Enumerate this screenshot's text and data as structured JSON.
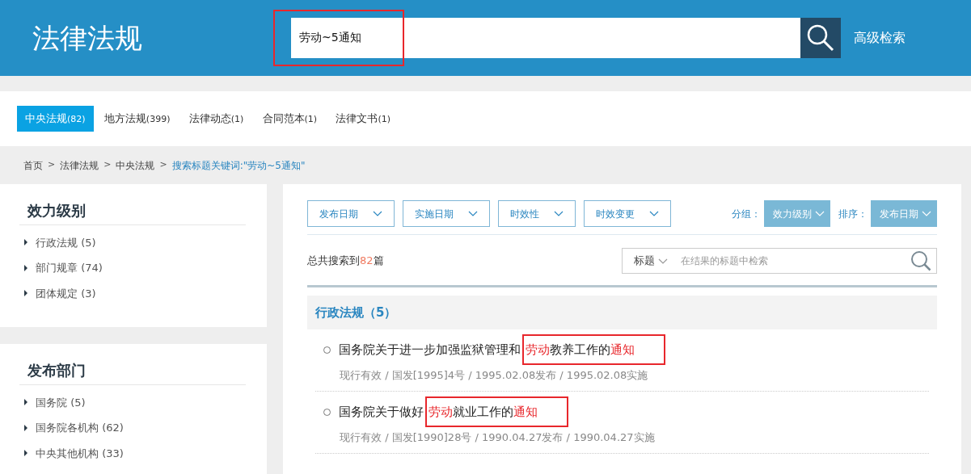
{
  "header": {
    "title": "法律法规",
    "search": {
      "value": "劳动~5通知",
      "annotated": true
    },
    "advanced_link": "高级检索"
  },
  "tabs": [
    {
      "label": "中央法规",
      "count": "(82)",
      "selected": true
    },
    {
      "label": "地方法规",
      "count": "(399)",
      "selected": false
    },
    {
      "label": "法律动态",
      "count": "(1)",
      "selected": false
    },
    {
      "label": "合同范本",
      "count": "(1)",
      "selected": false
    },
    {
      "label": "法律文书",
      "count": "(1)",
      "selected": false
    }
  ],
  "breadcrumb_separator": ">",
  "breadcrumb": [
    {
      "label": "首页",
      "current": false
    },
    {
      "label": "法律法规",
      "current": false
    },
    {
      "label": "中央法规",
      "current": false
    },
    {
      "label": "搜索标题关键词:\"劳动~5通知\"",
      "current": true
    }
  ],
  "sidebar": [
    {
      "title": "效力级别",
      "items": [
        "行政法规 (5)",
        "部门规章 (74)",
        "团体规定 (3)"
      ]
    },
    {
      "title": "发布部门",
      "items": [
        "国务院 (5)",
        "国务院各机构 (62)",
        "中央其他机构 (33)"
      ]
    }
  ],
  "filters": [
    {
      "label": "发布日期",
      "kind": "outline"
    },
    {
      "label": "实施日期",
      "kind": "outline"
    },
    {
      "label": "时效性",
      "kind": "outline"
    },
    {
      "label": "时效变更",
      "kind": "outline"
    },
    {
      "label": "分组：",
      "kind": "caption"
    },
    {
      "label": "效力级别",
      "kind": "solid"
    },
    {
      "label": "排序：",
      "kind": "caption"
    },
    {
      "label": "发布日期",
      "kind": "solid"
    }
  ],
  "summary": {
    "prefix": "总共搜索到",
    "count": "82",
    "suffix": "篇"
  },
  "result_search": {
    "scope": "标题",
    "placeholder": "在结果的标题中检索"
  },
  "group": {
    "title": "行政法规（5）"
  },
  "results": [
    {
      "annotated": true,
      "title": [
        {
          "text": "国务院关于进一步加强监狱管理和",
          "hit": false
        },
        {
          "text": "劳动",
          "hit": true
        },
        {
          "text": "教养工作的",
          "hit": false
        },
        {
          "text": "通知",
          "hit": true
        }
      ],
      "meta": "现行有效 / 国发[1995]4号 / 1995.02.08发布 / 1995.02.08实施"
    },
    {
      "annotated": true,
      "title": [
        {
          "text": "国务院关于做好",
          "hit": false
        },
        {
          "text": "劳动",
          "hit": true
        },
        {
          "text": "就业工作的",
          "hit": false
        },
        {
          "text": "通知",
          "hit": true
        }
      ],
      "meta": "现行有效 / 国发[1990]28号 / 1990.04.27发布 / 1990.04.27实施"
    }
  ]
}
